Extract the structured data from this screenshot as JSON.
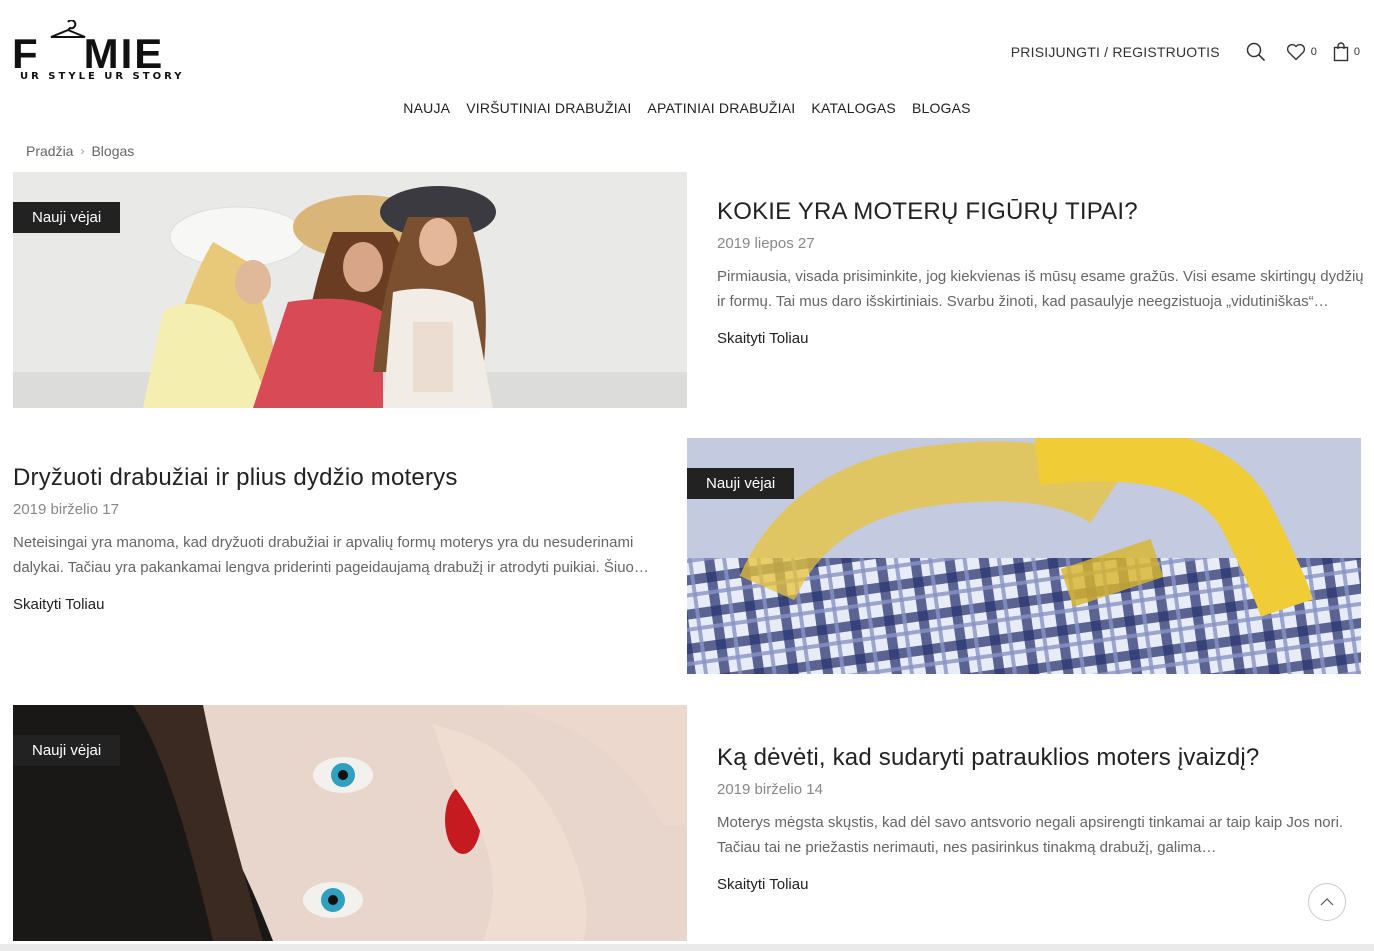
{
  "brand": {
    "logo_text": "F MIE",
    "tagline": "UR STYLE UR STORY"
  },
  "header": {
    "login_label": "PRISIJUNGTI / REGISTRUOTIS",
    "search_icon": "search-icon",
    "wishlist_count": "0",
    "cart_count": "0"
  },
  "nav": {
    "items": [
      {
        "label": "NAUJA"
      },
      {
        "label": "VIRŠUTINIAI DRABUŽIAI"
      },
      {
        "label": "APATINIAI DRABUŽIAI"
      },
      {
        "label": "KATALOGAS"
      },
      {
        "label": "BLOGAS"
      }
    ]
  },
  "breadcrumb": {
    "home": "Pradžia",
    "current": "Blogas"
  },
  "posts": [
    {
      "tag": "Nauji vėjai",
      "title": "KOKIE YRA MOTERŲ FIGŪRŲ TIPAI?",
      "date": "2019 liepos 27",
      "excerpt": "Pirmiausia, visada prisiminkite, jog kiekvienas iš mūsų esame gražūs. Visi esame skirtingų dydžių ir formų. Tai mus daro išskirtiniais. Svarbu žinoti, kad pasaulyje neegzistuoja „vidutiniškas“…",
      "read_more": "Skaityti Toliau"
    },
    {
      "tag": "Nauji vėjai",
      "title": "Dryžuoti drabužiai ir plius dydžio moterys",
      "date": "2019 birželio 17",
      "excerpt": "Neteisingai yra manoma, kad dryžuoti drabužiai ir apvalių formų moterys yra du nesuderinami dalykai. Tačiau yra pakankamai lengva priderinti pageidaujamą drabužį ir atrodyti puikiai. Šiuo…",
      "read_more": "Skaityti Toliau"
    },
    {
      "tag": "Nauji vėjai",
      "title": "Ką dėvėti, kad sudaryti patrauklios moters įvaizdį?",
      "date": "2019 birželio 14",
      "excerpt": "Moterys mėgsta skųstis, kad dėl savo antsvorio negali apsirengti tinkamai ar taip kaip Jos nori. Tačiau tai ne priežastis nerimauti, nes pasirinkus tinakmą drabužį, galima…",
      "read_more": "Skaityti Toliau"
    }
  ]
}
